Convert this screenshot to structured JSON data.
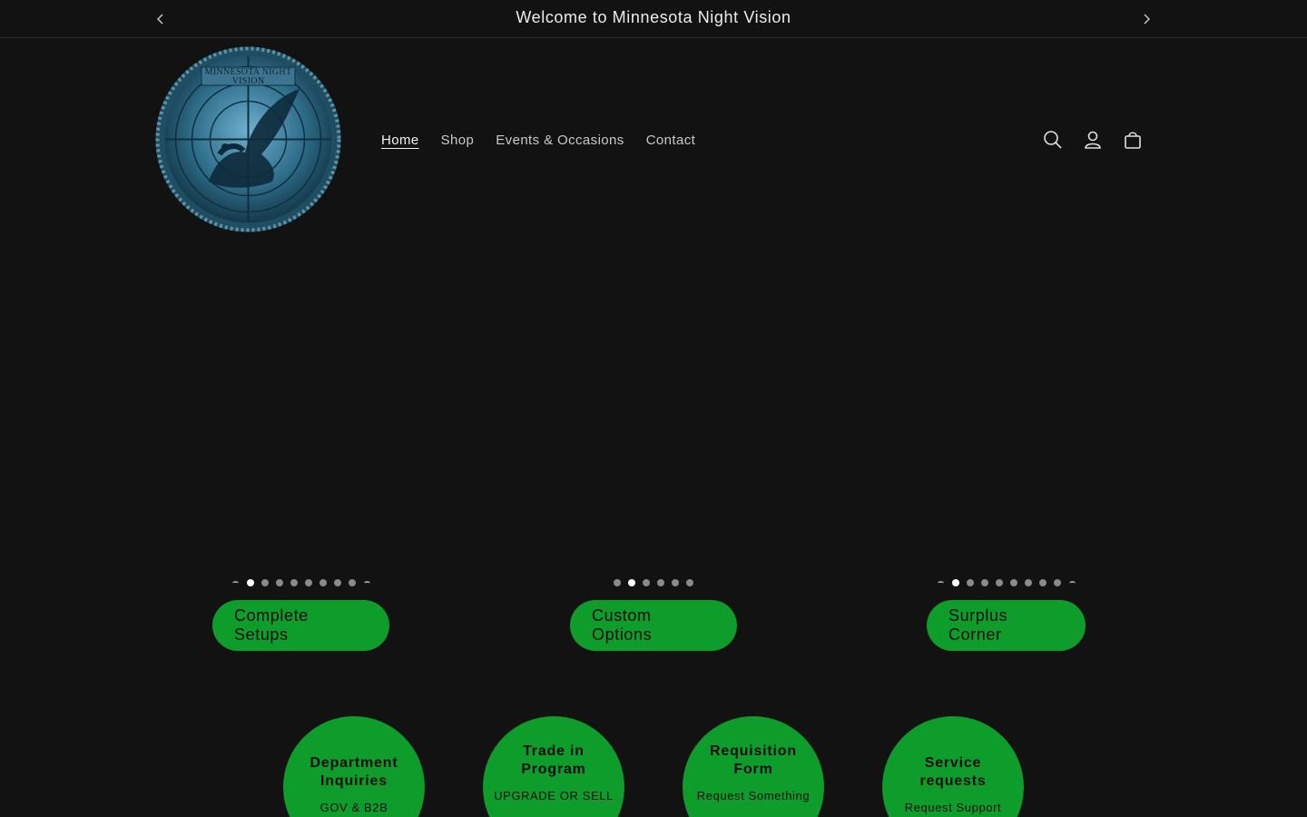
{
  "announcement": {
    "text": "Welcome to Minnesota Night Vision",
    "prev_icon": "chevron-left-icon",
    "next_icon": "chevron-right-icon"
  },
  "logo": {
    "text_line1": "MINNESOTA NIGHT",
    "text_line2": "VISION",
    "colors": {
      "ring": "#3f6f86",
      "inner": "#1a4a60",
      "bird": "#0d2a3a"
    }
  },
  "nav": {
    "items": [
      {
        "label": "Home",
        "active": true
      },
      {
        "label": "Shop",
        "active": false
      },
      {
        "label": "Events & Occasions",
        "active": false
      },
      {
        "label": "Contact",
        "active": false
      }
    ]
  },
  "header_icons": [
    "search-icon",
    "account-icon",
    "cart-icon"
  ],
  "collections": [
    {
      "label": "Complete Setups",
      "dots": 9,
      "active_dot": 1,
      "edge_ticks": true
    },
    {
      "label": "Custom Options",
      "dots": 6,
      "active_dot": 1,
      "edge_ticks": false
    },
    {
      "label": "Surplus Corner",
      "dots": 9,
      "active_dot": 1,
      "edge_ticks": true
    }
  ],
  "cards": [
    {
      "title": "Department Inquiries",
      "subtitle": "GOV & B2B"
    },
    {
      "title": "Trade in Program",
      "subtitle": "UPGRADE OR SELL"
    },
    {
      "title": "Requisition Form",
      "subtitle": "Request Something"
    },
    {
      "title": "Service requests",
      "subtitle": "Request Support"
    }
  ],
  "colors": {
    "background": "#121212",
    "accent_green": "#0e9c2b",
    "text": "#e6e6e6"
  }
}
